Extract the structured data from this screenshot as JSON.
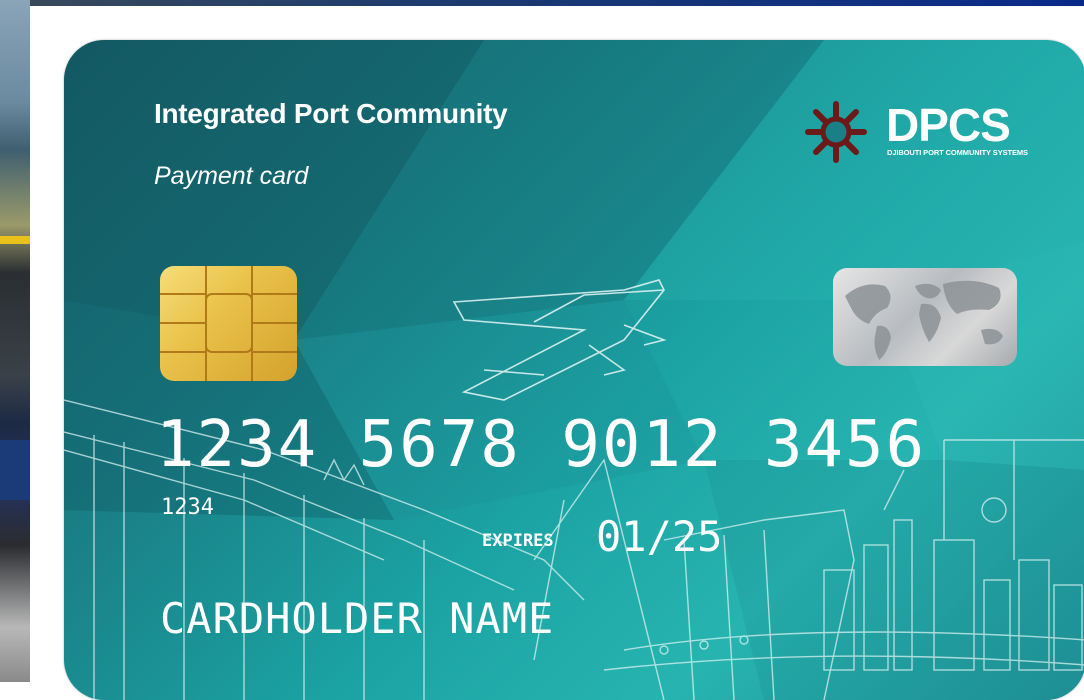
{
  "card": {
    "title": "Integrated Port Community",
    "subtitle": "Payment card",
    "logo": {
      "name": "DPCS",
      "tagline": "DJIBOUTI PORT COMMUNITY SYSTEMS",
      "icon": "port-wheel-icon",
      "icon_color": "#6b1a1a"
    },
    "number": "1234 5678 9012 3456",
    "number_short": "1234",
    "expires_label": "EXPIRES",
    "expiry": "01/25",
    "cardholder": "CARDHOLDER NAME",
    "chip": "emv-chip-icon",
    "hologram": "world-map-hologram-icon",
    "colors": {
      "card_base": "#1ba3a3",
      "text": "#ffffff",
      "chip": "#e9c24a"
    }
  }
}
